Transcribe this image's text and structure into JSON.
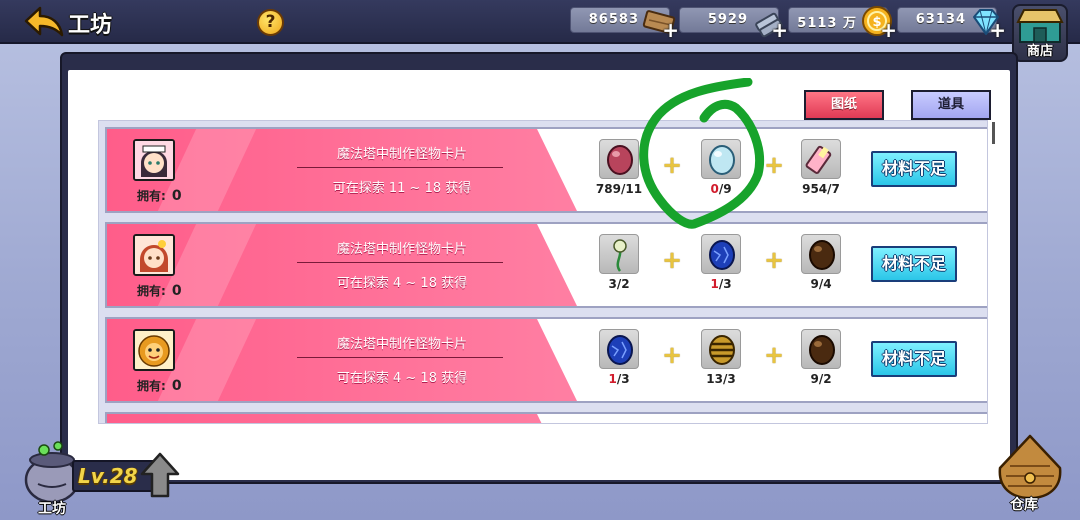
{
  "header": {
    "title": "工坊",
    "help_label": "?",
    "resources": [
      {
        "name": "wood",
        "icon": "wood-plank-icon",
        "value": "86583"
      },
      {
        "name": "metal",
        "icon": "steel-bars-icon",
        "value": "5929"
      },
      {
        "name": "gold",
        "icon": "gold-coin-icon",
        "value": "5113 万"
      },
      {
        "name": "diamond",
        "icon": "diamond-icon",
        "value": "63134"
      }
    ],
    "plus_label": "+",
    "shop_label": "商店"
  },
  "tabs": [
    {
      "label": "图纸",
      "selected": true
    },
    {
      "label": "道具",
      "selected": false
    }
  ],
  "recipes": [
    {
      "name": "魔法塔中制作怪物卡片",
      "source": "可在探索 11 ~ 18 获得",
      "owned_label": "拥有:",
      "owned": "0",
      "portrait": "maid-girl-portrait",
      "materials": [
        {
          "icon": "red-gem-icon",
          "have": "789",
          "need": "/11",
          "lacking": false
        },
        {
          "icon": "light-blue-gem-icon",
          "have": "0",
          "need": "/9",
          "lacking": true
        },
        {
          "icon": "pink-crystal-icon",
          "have": "954",
          "need": "/7",
          "lacking": false
        }
      ],
      "button": "材料不足"
    },
    {
      "name": "魔法塔中制作怪物卡片",
      "source": "可在探索 4 ~ 18 获得",
      "owned_label": "拥有:",
      "owned": "0",
      "portrait": "red-hair-girl-portrait",
      "materials": [
        {
          "icon": "flower-stem-icon",
          "have": "3",
          "need": "/2",
          "lacking": false
        },
        {
          "icon": "blue-orb-icon",
          "have": "1",
          "need": "/3",
          "lacking": true
        },
        {
          "icon": "brown-egg-icon",
          "have": "9",
          "need": "/4",
          "lacking": false
        }
      ],
      "button": "材料不足"
    },
    {
      "name": "魔法塔中制作怪物卡片",
      "source": "可在探索 4 ~ 18 获得",
      "owned_label": "拥有:",
      "owned": "0",
      "portrait": "lion-monster-portrait",
      "materials": [
        {
          "icon": "blue-orb-icon",
          "have": "1",
          "need": "/3",
          "lacking": true
        },
        {
          "icon": "striped-egg-icon",
          "have": "13",
          "need": "/3",
          "lacking": false
        },
        {
          "icon": "brown-egg-icon",
          "have": "9",
          "need": "/2",
          "lacking": false
        }
      ],
      "button": "材料不足"
    }
  ],
  "footer": {
    "workshop_label": "工坊",
    "level": "Lv.28",
    "warehouse_label": "仓库"
  },
  "colors": {
    "accent_pink": "#ff5d8a",
    "button_cyan": "#2bc6e8",
    "lacking_red": "#d11c2c",
    "annotation_green": "#17a32b"
  }
}
